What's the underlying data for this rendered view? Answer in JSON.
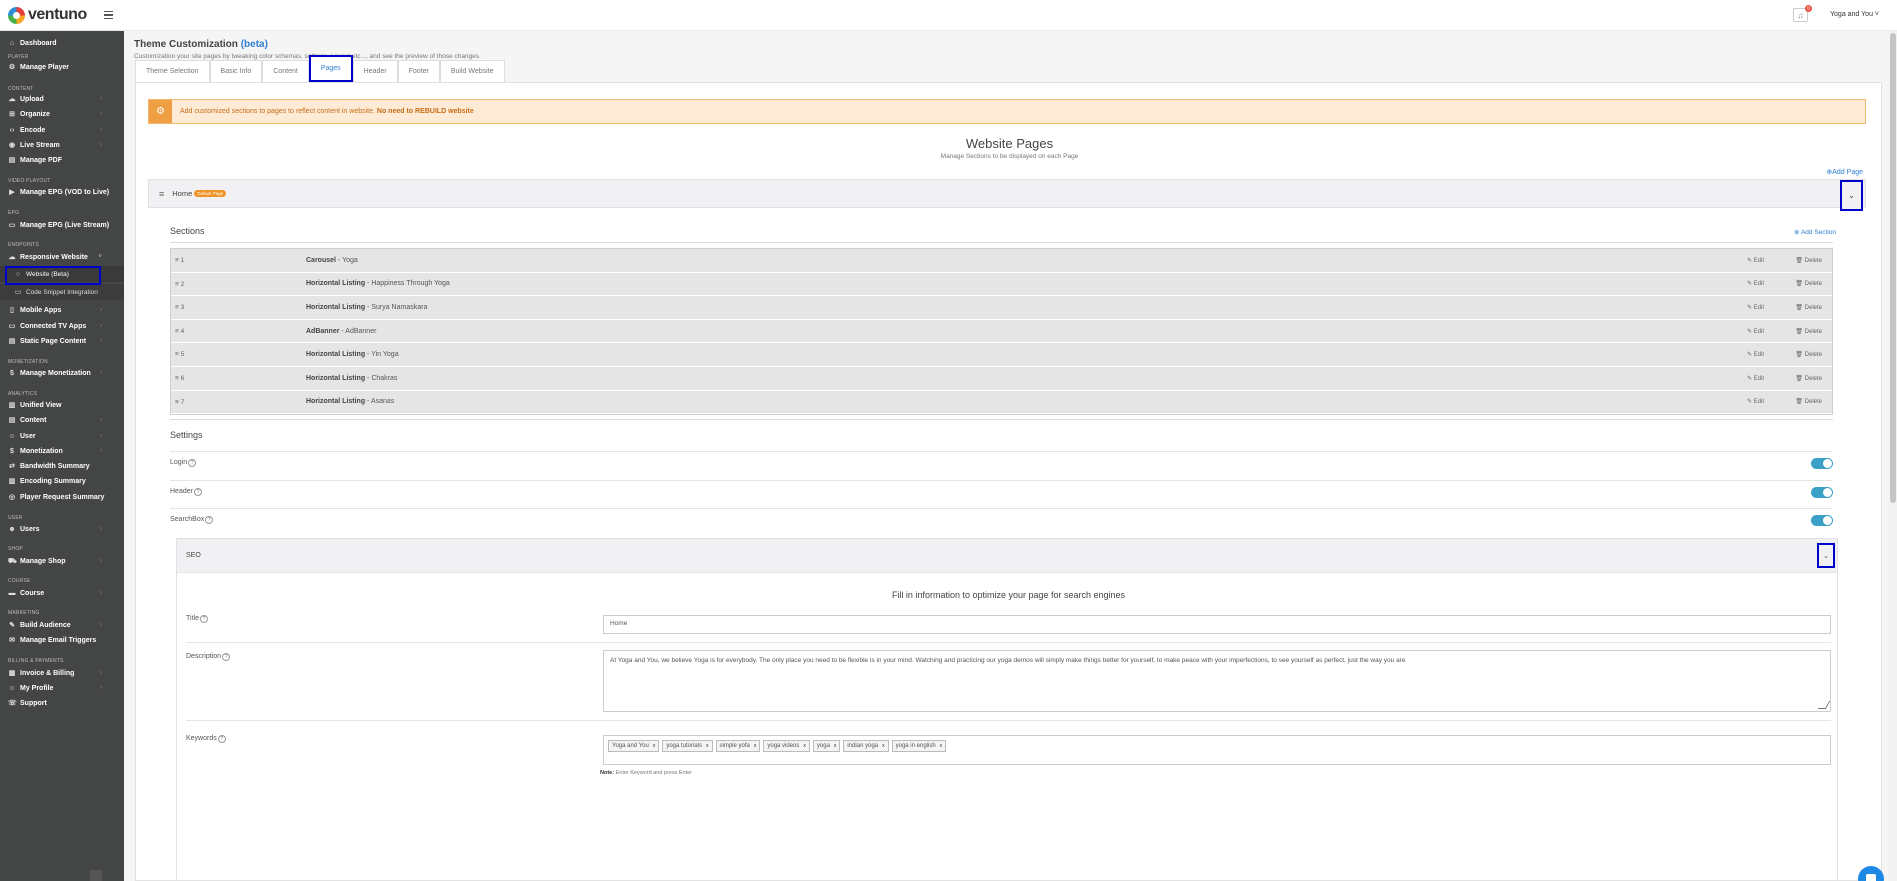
{
  "brand": {
    "name": "ventuno"
  },
  "topbar": {
    "notification_count": "0",
    "user_label": "Yoga and You ˅"
  },
  "sidebar": {
    "dashboard": "Dashboard",
    "sections": {
      "player": "PLAYER",
      "content": "CONTENT",
      "video_playout": "VIDEO PLAYOUT",
      "epg": "EPG",
      "endpoints": "ENDPOINTS",
      "monetization": "MONETIZATION",
      "analytics": "ANALYTICS",
      "user": "USER",
      "shop": "SHOP",
      "course": "COURSE",
      "marketing": "MARKETING",
      "billing": "BILLING & PAYMENTS"
    },
    "items": {
      "manage_player": "Manage Player",
      "upload": "Upload",
      "organize": "Organize",
      "encode": "Encode",
      "live_stream": "Live Stream",
      "manage_pdf": "Manage PDF",
      "manage_epg_vod": "Manage EPG (VOD to Live)",
      "manage_epg_live": "Manage EPG (Live Stream)",
      "responsive_website": "Responsive Website",
      "website_beta": "Website (Beta)",
      "code_snippet": "Code Snippet Integration",
      "mobile_apps": "Mobile Apps",
      "connected_tv": "Connected TV Apps",
      "static_page": "Static Page Content",
      "manage_monetization": "Manage Monetization",
      "unified_view": "Unified View",
      "content": "Content",
      "user": "User",
      "monetization": "Monetization",
      "bandwidth": "Bandwidth Summary",
      "encoding": "Encoding Summary",
      "player_request": "Player Request Summary",
      "users": "Users",
      "manage_shop": "Manage Shop",
      "course": "Course",
      "build_audience": "Build Audience",
      "manage_email": "Manage Email Triggers",
      "invoice": "Invoice & Billing",
      "my_profile": "My Profile",
      "support": "Support"
    }
  },
  "header": {
    "title": "Theme Customization",
    "title_beta": "(beta)",
    "subtitle": "Customization your site pages by tweaking color schemas, settings, Layout etc..., and see the preview of those changes."
  },
  "tabs": [
    "Theme Selection",
    "Basic Info",
    "Content",
    "Pages",
    "Header",
    "Footer",
    "Build Website"
  ],
  "info_bar": {
    "text": "Add customized sections to pages to reflect content in website.",
    "bold": "No need to REBUILD website"
  },
  "website_pages": {
    "title": "Website Pages",
    "subtitle": "Manage Sections to be displayed on each Page",
    "add_page": "Add Page"
  },
  "home": {
    "label": "Home",
    "badge": "Default Page"
  },
  "sections": {
    "title": "Sections",
    "add_section": "Add Section",
    "edit_label": "Edit",
    "delete_label": "Delete",
    "rows": [
      {
        "num": "1",
        "type": "Carousel",
        "name": " - Yoga"
      },
      {
        "num": "2",
        "type": "Horizontal Listing",
        "name": " - Happiness Through Yoga"
      },
      {
        "num": "3",
        "type": "Horizontal Listing",
        "name": " - Surya Namaskara"
      },
      {
        "num": "4",
        "type": "AdBanner",
        "name": " - AdBanner"
      },
      {
        "num": "5",
        "type": "Horizontal Listing",
        "name": " - Yin Yoga"
      },
      {
        "num": "6",
        "type": "Horizontal Listing",
        "name": " - Chakras"
      },
      {
        "num": "7",
        "type": "Horizontal Listing",
        "name": " - Asanas"
      }
    ]
  },
  "settings": {
    "title": "Settings",
    "login": "Login",
    "header": "Header",
    "searchbox": "SearchBox",
    "seo": "SEO"
  },
  "seo": {
    "heading": "Fill in information to optimize your page for search engines",
    "title_label": "Title",
    "title_value": "Home",
    "description_label": "Description",
    "description_value": "At Yoga and You, we believe Yoga is for everybody. The only place you need to be flexible is in your mind.  Watching and practicing our yoga demos will simply make things better for yourself, to make peace with your imperfections, to see yourself as perfect, just the way you are",
    "keywords_label": "Keywords",
    "keywords": [
      "Yoga and You",
      "yoga tutorials",
      "simple yofa",
      "yoga videos",
      "yoga",
      "indian yoga",
      "yoga in english"
    ],
    "note_label": "Note:",
    "note_text": " Enter Keyword and press Enter"
  }
}
